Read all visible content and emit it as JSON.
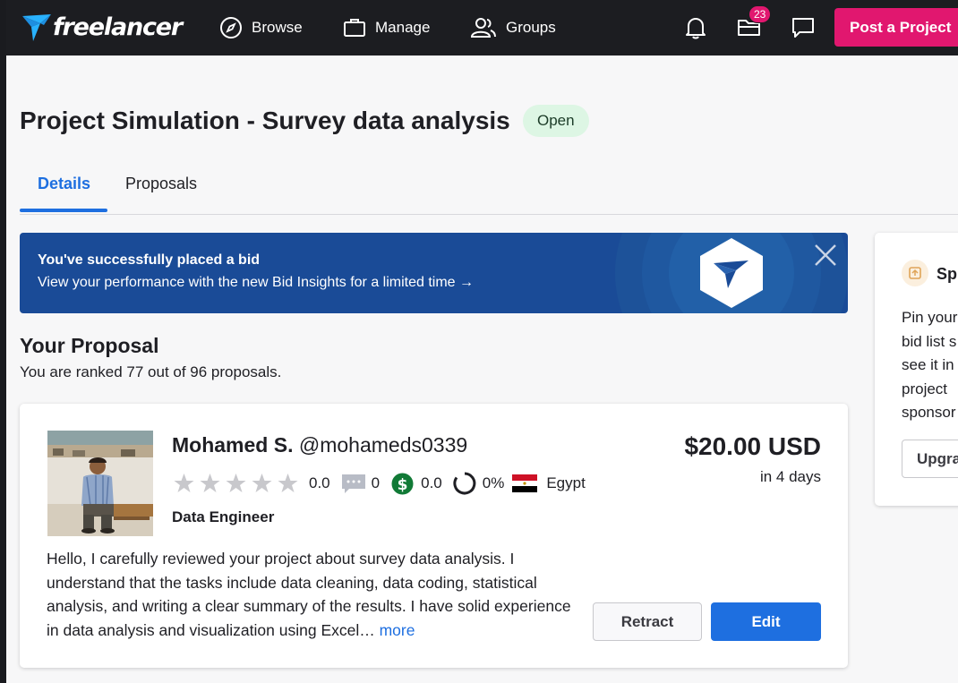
{
  "nav": {
    "brand": "freelancer",
    "items": [
      {
        "label": "Browse",
        "icon": "compass-icon"
      },
      {
        "label": "Manage",
        "icon": "briefcase-icon"
      },
      {
        "label": "Groups",
        "icon": "users-icon"
      }
    ],
    "notification_count": "23",
    "post_button": "Post a Project"
  },
  "project": {
    "title": "Project Simulation - Survey data analysis",
    "status": "Open"
  },
  "tabs": [
    "Details",
    "Proposals"
  ],
  "banner": {
    "title": "You've successfully placed a bid",
    "subtitle": "View your performance with the new Bid Insights for a limited time →"
  },
  "proposal": {
    "section_title": "Your Proposal",
    "rank_text": "You are ranked 77 out of 96 proposals.",
    "name": "Mohamed S.",
    "username": "@mohameds0339",
    "rating": "0.0",
    "reviews": "0",
    "earnings_score": "0.0",
    "completion": "0%",
    "country": "Egypt",
    "role": "Data Engineer",
    "price": "$20.00 USD",
    "delivery": "in 4 days",
    "description": "Hello, I carefully reviewed your project about survey data analysis. I understand that the tasks include data cleaning, data coding, statistical analysis, and writing a clear summary of the results. I have solid experience in data analysis and visualization using Excel…",
    "more_link": "more",
    "retract_label": "Retract",
    "edit_label": "Edit"
  },
  "sidebar": {
    "title": "Sp",
    "lines": [
      "Pin your",
      "bid list s",
      "see it in",
      "project",
      "sponsor"
    ],
    "button": "Upgra"
  },
  "colors": {
    "accent": "#1e6fe0",
    "brand_pink": "#e1176f",
    "navbar": "#1c1d21",
    "banner": "#1a4b97"
  }
}
